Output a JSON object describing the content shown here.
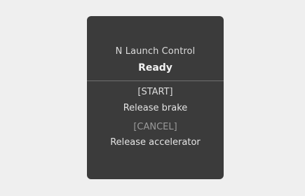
{
  "dialog": {
    "title": "N Launch Control",
    "status": "Ready",
    "start": {
      "key": "[START]",
      "action": "Release brake"
    },
    "cancel": {
      "key": "[CANCEL]",
      "action": "Release accelerator"
    }
  },
  "colors": {
    "page_background": "#efefef",
    "panel_background": "#3b3b3b",
    "text_primary": "#f2f2f2",
    "text_secondary": "#dcdcdc",
    "text_dimmed": "#9a9a9a",
    "divider": "#707070"
  }
}
